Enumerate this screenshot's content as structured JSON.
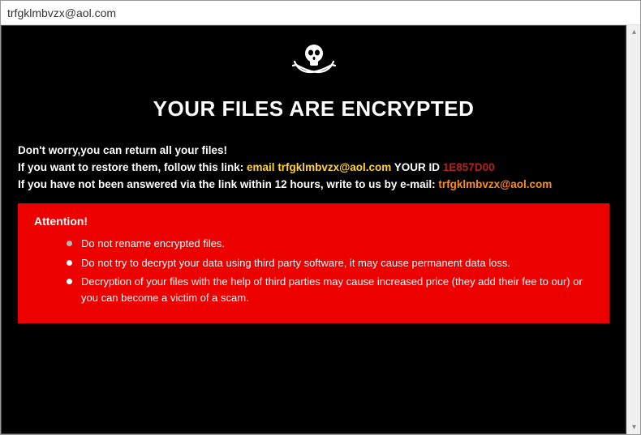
{
  "window": {
    "title": "trfgklmbvzx@aol.com"
  },
  "content": {
    "heading": "YOUR FILES ARE ENCRYPTED",
    "intro": "Don't worry,you can return all your files!",
    "line2_prefix": "If you want to restore them, follow this link: ",
    "line2_email_label": "email ",
    "line2_email": "trfgklmbvzx@aol.com",
    "line2_id_label": "  YOUR ID ",
    "line2_id": "1E857D00",
    "line3_prefix": "If you have not been answered via the link within 12 hours, write to us by e-mail: ",
    "line3_email": "trfgklmbvzx@aol.com"
  },
  "attention": {
    "title": "Attention!",
    "items": [
      "Do not rename encrypted files.",
      "Do not try to decrypt your data using third party software, it may cause permanent data loss.",
      "Decryption of your files with the help of third parties may cause increased price (they add their fee to our) or you can become a victim of a scam."
    ]
  },
  "scroll": {
    "up": "▴",
    "down": "▾"
  }
}
